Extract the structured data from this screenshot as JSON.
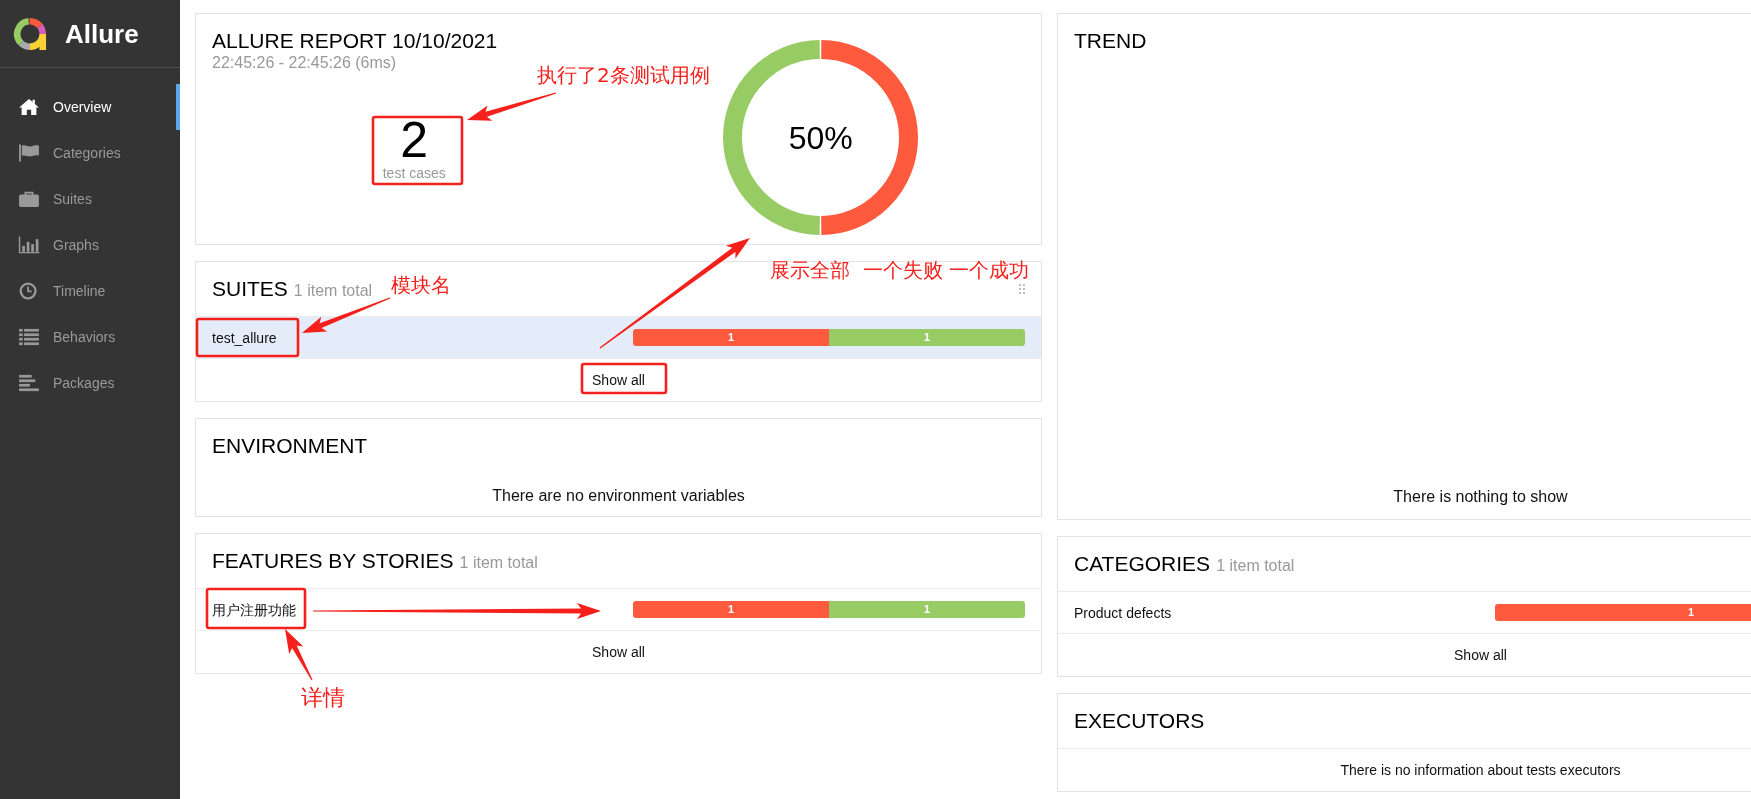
{
  "sidebar": {
    "app_name": "Allure",
    "items": [
      {
        "label": "Overview",
        "selected": true
      },
      {
        "label": "Categories",
        "selected": false
      },
      {
        "label": "Suites",
        "selected": false
      },
      {
        "label": "Graphs",
        "selected": false
      },
      {
        "label": "Timeline",
        "selected": false
      },
      {
        "label": "Behaviors",
        "selected": false
      },
      {
        "label": "Packages",
        "selected": false
      }
    ]
  },
  "left_widgets": [
    {
      "kind": "summary",
      "title": "ALLURE REPORT 10/10/2021",
      "subtitle": "22:45:26 - 22:45:26 (6ms)",
      "count": "2",
      "count_label": "test cases",
      "donut": {
        "percent": "50%",
        "level": 0.5
      }
    },
    {
      "kind": "list",
      "title": "SUITES",
      "total": "1 item total",
      "grip": true,
      "rows": [
        {
          "name": "test_allure",
          "selected": true,
          "bar": [
            {
              "value": "1",
              "color": "#fd5a3e",
              "level": 0.5
            },
            {
              "value": "1",
              "color": "#97cc64",
              "level": 0.5
            }
          ]
        }
      ],
      "footer": "Show all"
    },
    {
      "kind": "message",
      "title": "ENVIRONMENT",
      "message": "There are no environment variables"
    },
    {
      "kind": "list",
      "title": "FEATURES BY STORIES",
      "total": "1 item total",
      "grip": false,
      "rows": [
        {
          "name": "用户注册功能",
          "selected": false,
          "bar": [
            {
              "value": "1",
              "color": "#fd5a3e",
              "level": 0.5
            },
            {
              "value": "1",
              "color": "#97cc64",
              "level": 0.5
            }
          ]
        }
      ],
      "footer": "Show all"
    }
  ],
  "right_widgets": [
    {
      "kind": "trend",
      "title": "TREND",
      "message": "There is nothing to show"
    },
    {
      "kind": "list",
      "title": "CATEGORIES",
      "total": "1 item total",
      "grip": false,
      "rows": [
        {
          "name": "Product defects",
          "selected": false,
          "bar": [
            {
              "value": "1",
              "color": "#fd5a3e",
              "level": 1
            }
          ]
        }
      ],
      "footer": "Show all"
    },
    {
      "kind": "table_message",
      "title": "EXECUTORS",
      "message": "There is no information about tests executors"
    }
  ],
  "annotations": [
    {
      "text": "执行了2条测试用例"
    },
    {
      "text": "模块名"
    },
    {
      "text": "展示全部  一个失败 一个成功"
    },
    {
      "text": "详情"
    }
  ]
}
